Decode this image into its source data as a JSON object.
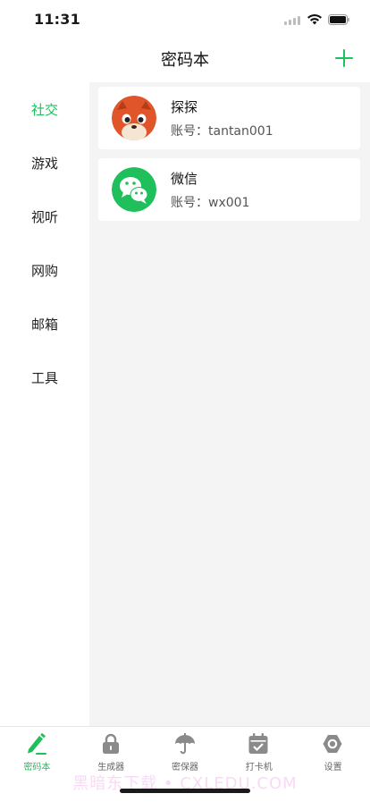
{
  "status": {
    "time": "11:31"
  },
  "header": {
    "title": "密码本",
    "add_icon": "plus-icon"
  },
  "categories": [
    {
      "label": "社交",
      "active": true
    },
    {
      "label": "游戏",
      "active": false
    },
    {
      "label": "视听",
      "active": false
    },
    {
      "label": "网购",
      "active": false
    },
    {
      "label": "邮箱",
      "active": false
    },
    {
      "label": "工具",
      "active": false
    }
  ],
  "accounts": [
    {
      "name": "探探",
      "account_prefix": "账号：",
      "account": "tantan001",
      "icon": "tantan-fox-icon"
    },
    {
      "name": "微信",
      "account_prefix": "账号：",
      "account": "wx001",
      "icon": "wechat-icon"
    }
  ],
  "tabs": [
    {
      "label": "密码本",
      "icon": "pencil-icon",
      "active": true
    },
    {
      "label": "生成器",
      "icon": "lock-icon",
      "active": false
    },
    {
      "label": "密保器",
      "icon": "umbrella-icon",
      "active": false
    },
    {
      "label": "打卡机",
      "icon": "calendar-check-icon",
      "active": false
    },
    {
      "label": "设置",
      "icon": "gear-icon",
      "active": false
    }
  ],
  "watermark": "黑暗东下载 • CXLEDU.COM",
  "colors": {
    "accent": "#1fbf5b",
    "content_bg": "#f4f4f4",
    "tab_inactive": "#8a8a8a"
  }
}
